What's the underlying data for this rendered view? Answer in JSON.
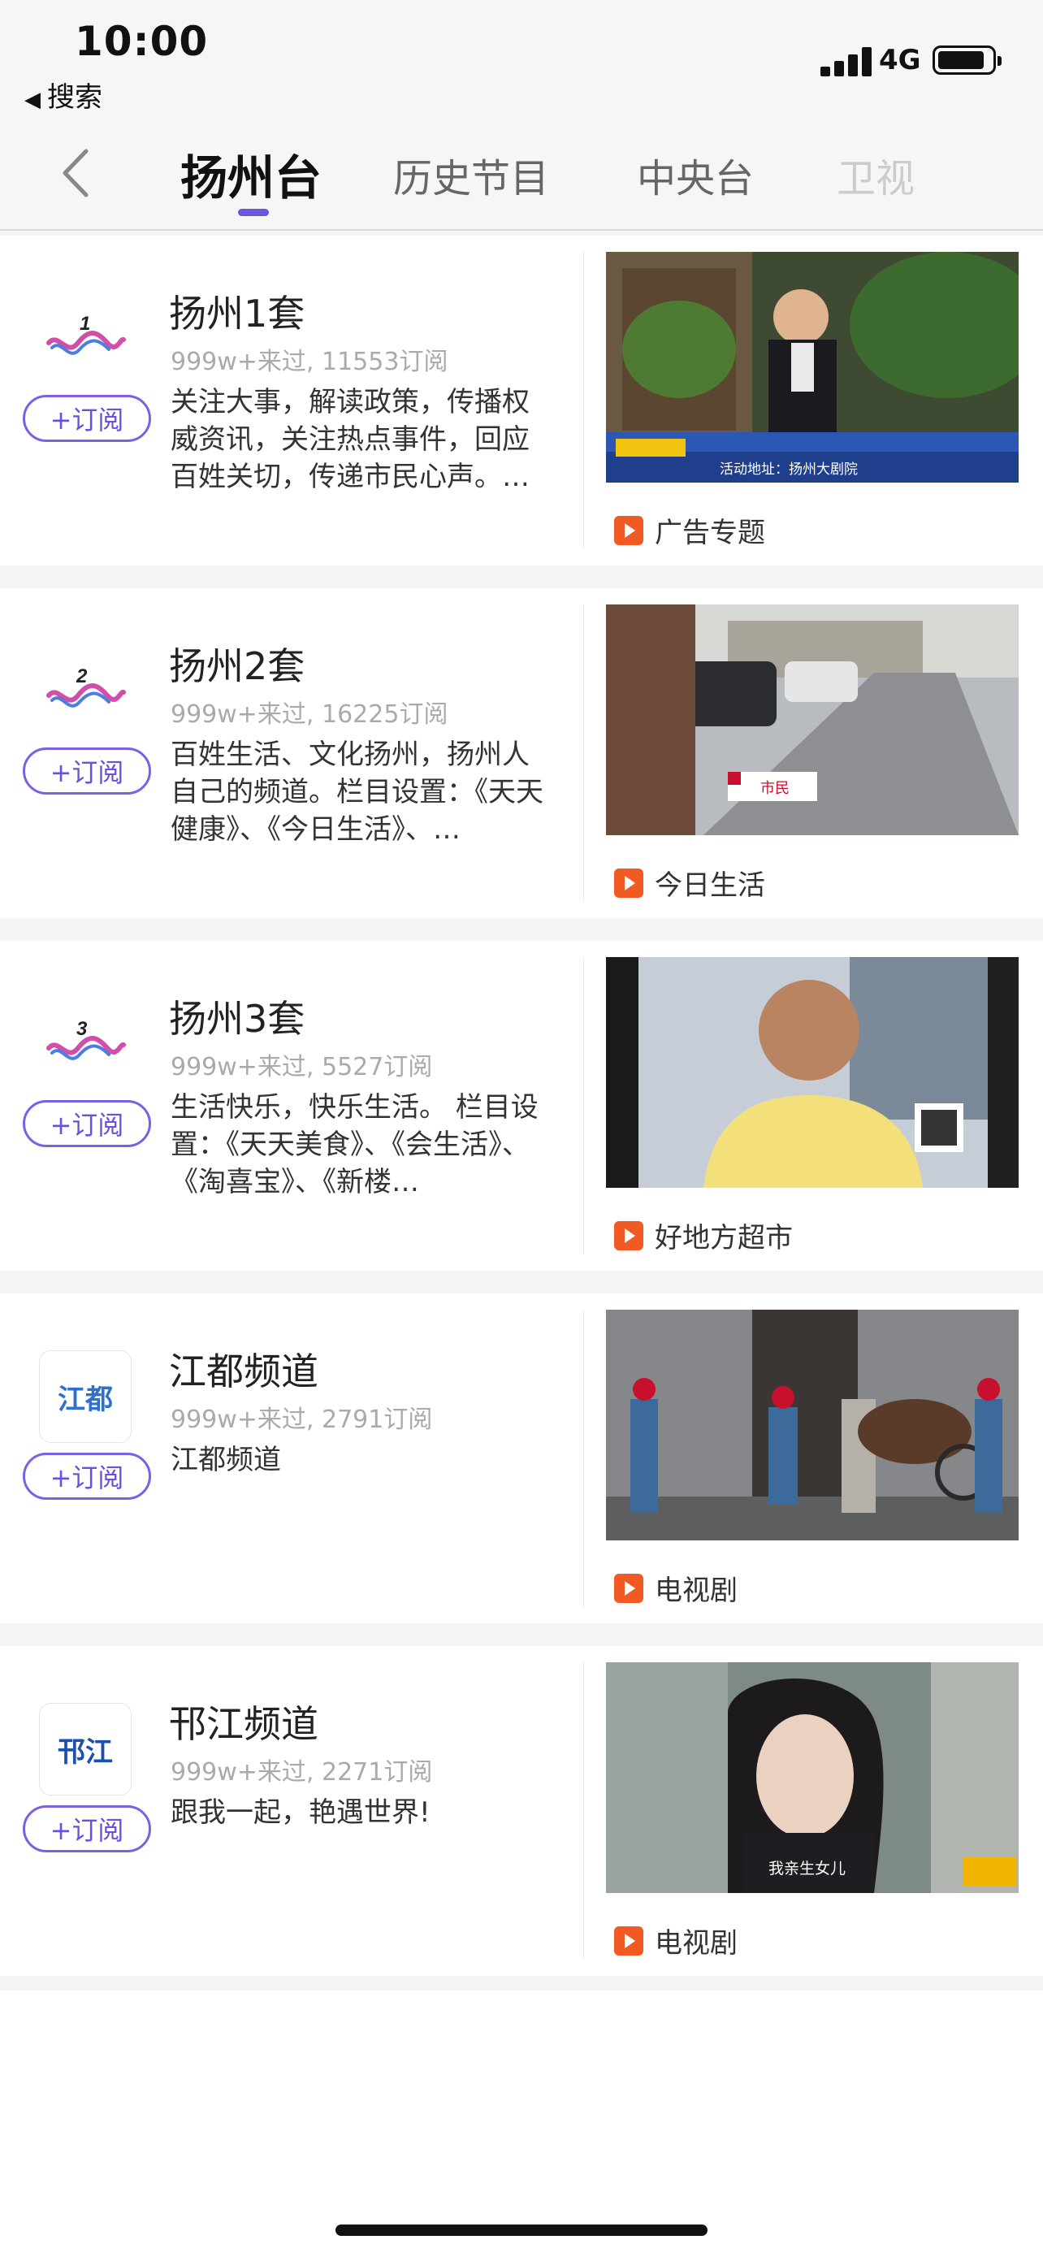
{
  "status_bar": {
    "time": "10:00",
    "back_app": "搜索",
    "network": "4G"
  },
  "tabs": [
    {
      "label": "扬州台",
      "active": true
    },
    {
      "label": "历史节目",
      "active": false
    },
    {
      "label": "中央台",
      "active": false
    },
    {
      "label": "卫视",
      "active": false
    }
  ],
  "subscribe_label": "+订阅",
  "channels": [
    {
      "name": "扬州1套",
      "stats": "999w+来过, 11553订阅",
      "description": "关注大事，解读政策，传播权威资讯，关注热点事件，回应百姓关切，传递市民心声。…",
      "program": "广告专题",
      "logo_number": "1"
    },
    {
      "name": "扬州2套",
      "stats": "999w+来过, 16225订阅",
      "description": "百姓生活、文化扬州，扬州人自己的频道。栏目设置：《天天健康》、《今日生活》、…",
      "program": "今日生活",
      "logo_number": "2"
    },
    {
      "name": "扬州3套",
      "stats": "999w+来过, 5527订阅",
      "description": "生活快乐，快乐生活。 栏目设置：《天天美食》、《会生活》、《淘喜宝》、《新楼…",
      "program": "好地方超市",
      "logo_number": "3"
    },
    {
      "name": "江都频道",
      "stats": "999w+来过, 2791订阅",
      "description": "江都频道",
      "program": "电视剧",
      "logo_text": "江都"
    },
    {
      "name": "邗江频道",
      "stats": "999w+来过, 2271订阅",
      "description": "跟我一起，艳遇世界!",
      "program": "电视剧",
      "logo_text": "邗江"
    }
  ],
  "thumbnail_captions": {
    "ch1_banner": "活动地址：扬州大剧院",
    "ch2_tag": "市民",
    "ch5_subtitle": "我亲生女儿"
  },
  "colors": {
    "accent": "#6b56e0",
    "play_badge": "#f25a24"
  }
}
